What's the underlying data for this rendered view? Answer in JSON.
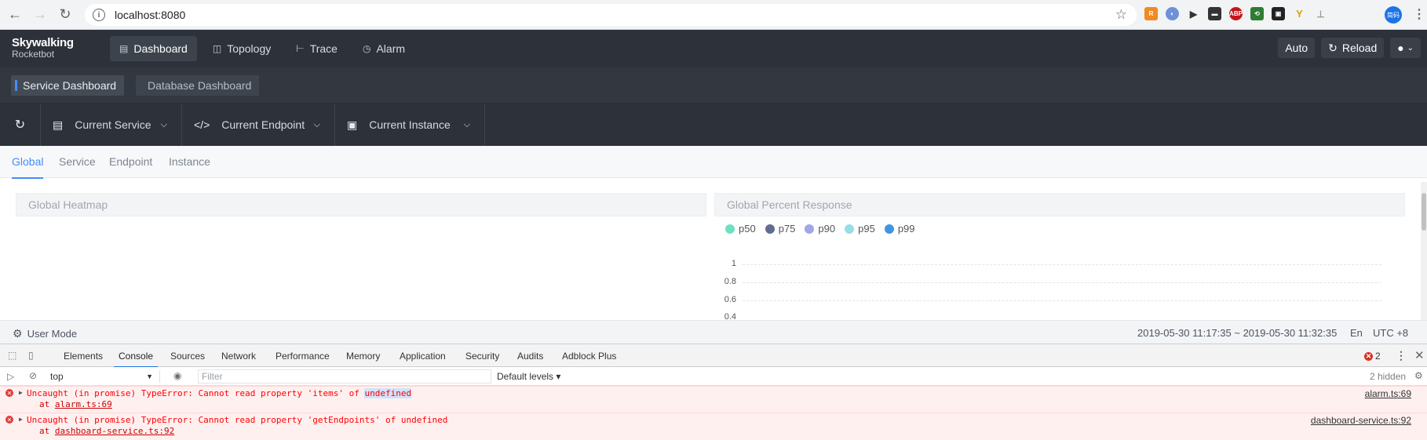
{
  "browser": {
    "url": "localhost:8080",
    "profile_label": "简码"
  },
  "app": {
    "logo_main": "Skywalking",
    "logo_sub": "Rocketbot",
    "nav": [
      {
        "label": "Dashboard",
        "icon": "chart-icon",
        "active": true
      },
      {
        "label": "Topology",
        "icon": "topology-icon"
      },
      {
        "label": "Trace",
        "icon": "trace-icon"
      },
      {
        "label": "Alarm",
        "icon": "alarm-icon"
      }
    ],
    "auto_label": "Auto",
    "reload_label": "Reload"
  },
  "dashboard_tabs": [
    "Service Dashboard",
    "Database Dashboard"
  ],
  "selectors": {
    "service": "Current Service",
    "endpoint": "Current Endpoint",
    "instance": "Current Instance"
  },
  "sub_tabs": [
    "Global",
    "Service",
    "Endpoint",
    "Instance"
  ],
  "panels": {
    "heatmap_title": "Global Heatmap",
    "percent_title": "Global Percent Response",
    "legend": [
      {
        "label": "p50",
        "color": "#6ee0c4"
      },
      {
        "label": "p75",
        "color": "#626c91"
      },
      {
        "label": "p90",
        "color": "#a0a7e6"
      },
      {
        "label": "p95",
        "color": "#96dee8"
      },
      {
        "label": "p99",
        "color": "#3f96e3"
      }
    ],
    "y_ticks": [
      "1",
      "0.8",
      "0.6",
      "0.4"
    ]
  },
  "footer": {
    "mode": "User Mode",
    "range": "2019-05-30 11:17:35 ~ 2019-05-30 11:32:35",
    "lang": "En",
    "tz": "UTC +8"
  },
  "devtools": {
    "tabs": [
      "Elements",
      "Console",
      "Sources",
      "Network",
      "Performance",
      "Memory",
      "Application",
      "Security",
      "Audits",
      "Adblock Plus"
    ],
    "error_count": "2",
    "context": "top",
    "filter_placeholder": "Filter",
    "levels": "Default levels ▾",
    "hidden": "2 hidden",
    "errors": [
      {
        "msg_pre": "Uncaught (in promise) TypeError: Cannot read property 'items' of ",
        "msg_hl": "undefined",
        "at_pre": "at ",
        "at_link": "alarm.ts:69",
        "source": "alarm.ts:69"
      },
      {
        "msg_pre": "Uncaught (in promise) TypeError: Cannot read property 'getEndpoints' of undefined",
        "msg_hl": "",
        "at_pre": "at ",
        "at_link": "dashboard-service.ts:92",
        "source": "dashboard-service.ts:92"
      }
    ]
  }
}
